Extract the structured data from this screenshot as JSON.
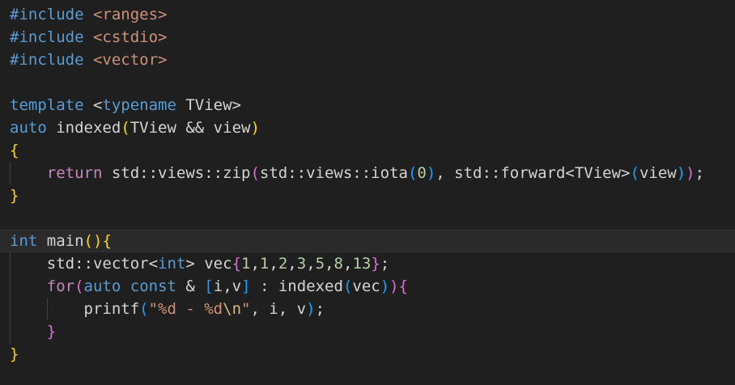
{
  "editor": {
    "language": "cpp",
    "theme_colors": {
      "background": "#1f1f1f",
      "keyword": "#569cd6",
      "control": "#c586c0",
      "string": "#ce9178",
      "number": "#b5cea8",
      "text": "#d4d4d4",
      "bracket_level1": "#ffd700",
      "bracket_level2": "#da70d6",
      "bracket_level3": "#179fff"
    },
    "current_line": 10,
    "lines": [
      {
        "guides": [],
        "tokens": [
          [
            "#include",
            "inc"
          ],
          [
            " ",
            "plain"
          ],
          [
            "<ranges>",
            "str"
          ]
        ]
      },
      {
        "guides": [],
        "tokens": [
          [
            "#include",
            "inc"
          ],
          [
            " ",
            "plain"
          ],
          [
            "<cstdio>",
            "str"
          ]
        ]
      },
      {
        "guides": [],
        "tokens": [
          [
            "#include",
            "inc"
          ],
          [
            " ",
            "plain"
          ],
          [
            "<vector>",
            "str"
          ]
        ]
      },
      {
        "guides": [],
        "tokens": []
      },
      {
        "guides": [],
        "tokens": [
          [
            "template",
            "kw"
          ],
          [
            " <",
            "plain"
          ],
          [
            "typename",
            "kw"
          ],
          [
            " TView>",
            "plain"
          ]
        ]
      },
      {
        "guides": [],
        "tokens": [
          [
            "auto",
            "kw"
          ],
          [
            " indexed",
            "plain"
          ],
          [
            "(",
            "b1"
          ],
          [
            "TView && view",
            "plain"
          ],
          [
            ")",
            "b1"
          ]
        ]
      },
      {
        "guides": [],
        "tokens": [
          [
            "{",
            "b1"
          ]
        ]
      },
      {
        "guides": [
          1
        ],
        "tokens": [
          [
            "    ",
            "plain"
          ],
          [
            "return",
            "ctrl"
          ],
          [
            " std::views::zip",
            "plain"
          ],
          [
            "(",
            "b2"
          ],
          [
            "std::views::iota",
            "plain"
          ],
          [
            "(",
            "b3"
          ],
          [
            "0",
            "num"
          ],
          [
            ")",
            "b3"
          ],
          [
            ", std::forward<TView>",
            "plain"
          ],
          [
            "(",
            "b3"
          ],
          [
            "view",
            "plain"
          ],
          [
            ")",
            "b3"
          ],
          [
            ")",
            "b2"
          ],
          [
            ";",
            "plain"
          ]
        ]
      },
      {
        "guides": [],
        "tokens": [
          [
            "}",
            "b1"
          ]
        ]
      },
      {
        "guides": [],
        "tokens": []
      },
      {
        "guides": [],
        "tokens": [
          [
            "int",
            "kw"
          ],
          [
            " main",
            "plain"
          ],
          [
            "(",
            "b1"
          ],
          [
            ")",
            "b1"
          ],
          [
            "{",
            "b1"
          ]
        ]
      },
      {
        "guides": [
          1
        ],
        "tokens": [
          [
            "    std::vector<",
            "plain"
          ],
          [
            "int",
            "kw"
          ],
          [
            "> vec",
            "plain"
          ],
          [
            "{",
            "b2"
          ],
          [
            "1",
            "num"
          ],
          [
            ",",
            "plain"
          ],
          [
            "1",
            "num"
          ],
          [
            ",",
            "plain"
          ],
          [
            "2",
            "num"
          ],
          [
            ",",
            "plain"
          ],
          [
            "3",
            "num"
          ],
          [
            ",",
            "plain"
          ],
          [
            "5",
            "num"
          ],
          [
            ",",
            "plain"
          ],
          [
            "8",
            "num"
          ],
          [
            ",",
            "plain"
          ],
          [
            "13",
            "num"
          ],
          [
            "}",
            "b2"
          ],
          [
            ";",
            "plain"
          ]
        ]
      },
      {
        "guides": [
          1
        ],
        "tokens": [
          [
            "    ",
            "plain"
          ],
          [
            "for",
            "ctrl"
          ],
          [
            "(",
            "b2"
          ],
          [
            "auto",
            "kw"
          ],
          [
            " ",
            "plain"
          ],
          [
            "const",
            "kw"
          ],
          [
            " & ",
            "plain"
          ],
          [
            "[",
            "b3"
          ],
          [
            "i,v",
            "plain"
          ],
          [
            "]",
            "b3"
          ],
          [
            " : indexed",
            "plain"
          ],
          [
            "(",
            "b3"
          ],
          [
            "vec",
            "plain"
          ],
          [
            ")",
            "b3"
          ],
          [
            ")",
            "b2"
          ],
          [
            "{",
            "b2"
          ]
        ]
      },
      {
        "guides": [
          1,
          2
        ],
        "tokens": [
          [
            "        printf",
            "plain"
          ],
          [
            "(",
            "b3"
          ],
          [
            "\"%d - %d",
            "str"
          ],
          [
            "\\n",
            "esc"
          ],
          [
            "\"",
            "str"
          ],
          [
            ", i, v",
            "plain"
          ],
          [
            ")",
            "b3"
          ],
          [
            ";",
            "plain"
          ]
        ]
      },
      {
        "guides": [
          1
        ],
        "tokens": [
          [
            "    ",
            "plain"
          ],
          [
            "}",
            "b2"
          ]
        ]
      },
      {
        "guides": [],
        "tokens": [
          [
            "}",
            "b1"
          ]
        ]
      }
    ]
  }
}
